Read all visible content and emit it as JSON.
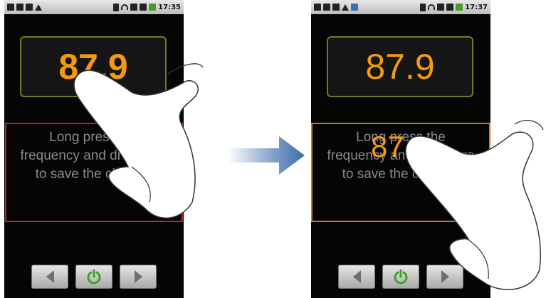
{
  "colors": {
    "accent_orange": "#f59a0e",
    "frame_green": "#6b7f1c",
    "drop_border_default": "#c42020",
    "drop_border_active": "#d27a10",
    "power_green": "#3aa621",
    "arrow_blue": "#3f6ea8"
  },
  "left_screen": {
    "status_time": "17:35",
    "frequency": "87.9",
    "drop_hint": {
      "line1": "Long press the",
      "line2": "frequency and drag here",
      "line3": "to save the channel"
    }
  },
  "right_screen": {
    "status_time": "17:37",
    "frequency": "87.9",
    "drop_hint": {
      "line1": "Long press the",
      "line2": "frequency and drag here",
      "line3": "to save the channel"
    },
    "dragged_frequency": "87.9"
  },
  "controls": {
    "prev_icon": "chevron-left-icon",
    "power_icon": "power-icon",
    "next_icon": "chevron-right-icon"
  },
  "transition_icon": "arrow-right-icon"
}
